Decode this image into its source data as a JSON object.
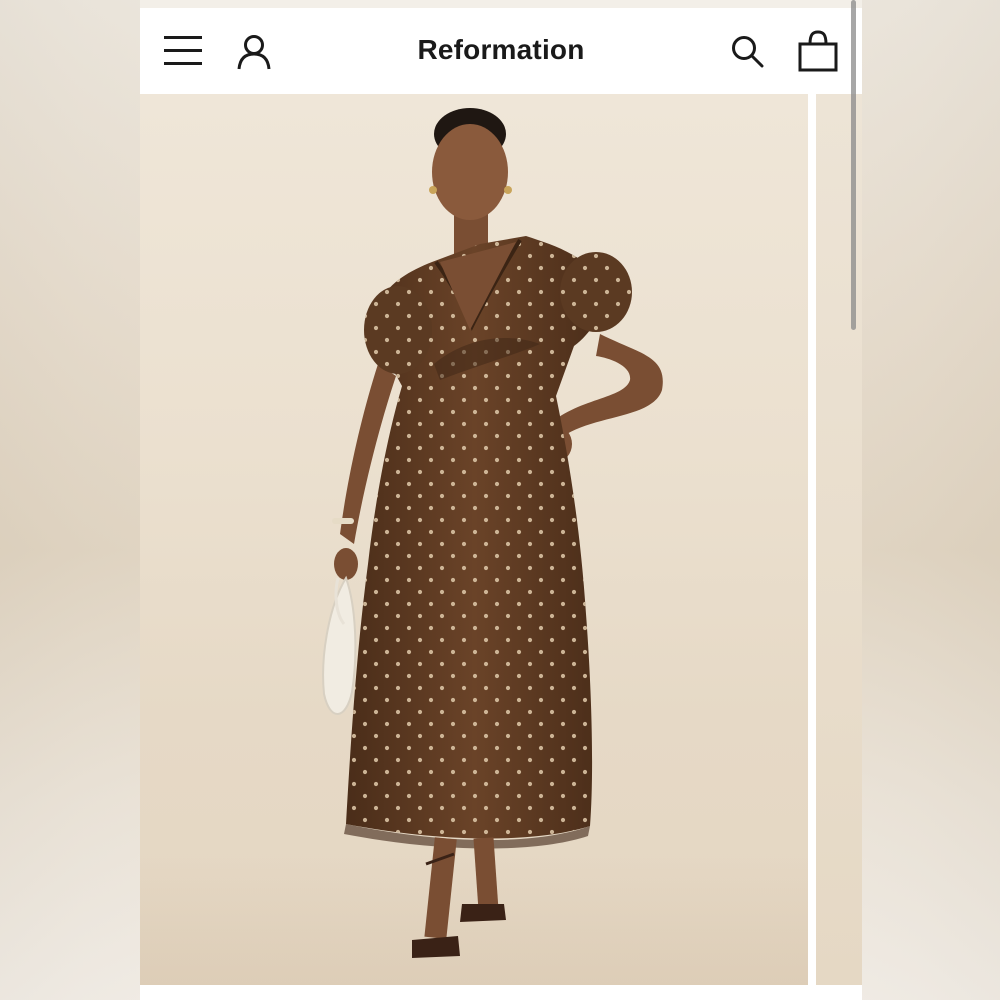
{
  "header": {
    "brand": "Reformation",
    "icons": [
      "menu-icon",
      "account-icon",
      "search-icon",
      "shopping-bag-icon"
    ]
  },
  "colors": {
    "background": "#ffffff",
    "text": "#1a1a1a",
    "product_backdrop": "#ebe0cf",
    "dress": "#5b3a22",
    "dot": "#d9c2a3"
  }
}
